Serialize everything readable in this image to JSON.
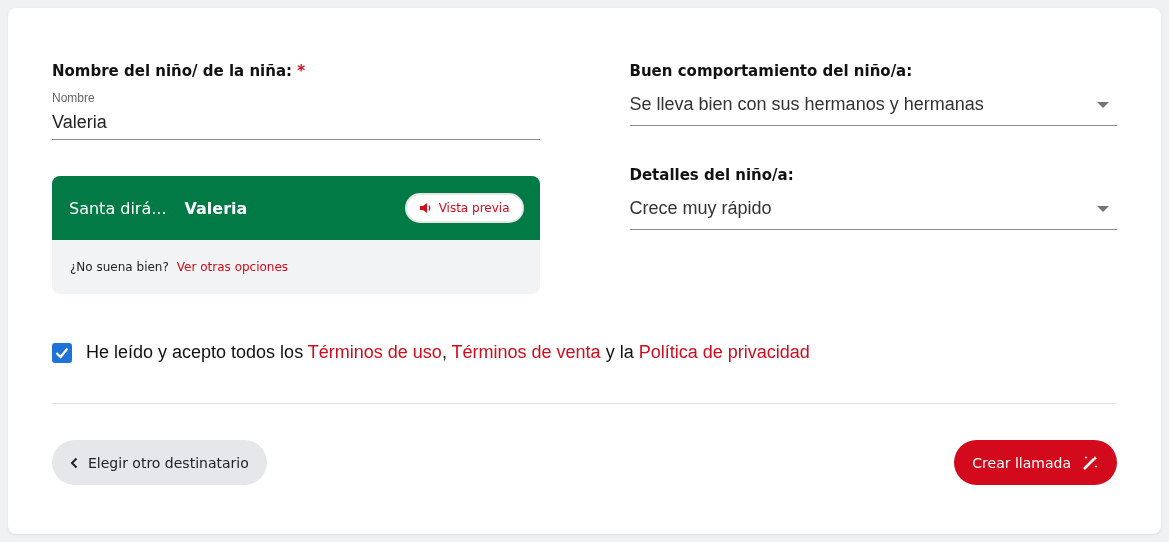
{
  "name_field": {
    "label": "Nombre del niño/ de la niña:",
    "required_mark": "*",
    "floating_label": "Nombre",
    "value": "Valeria"
  },
  "preview": {
    "lead": "Santa dirá...",
    "name": "Valeria",
    "button": "Vista previa",
    "question": "¿No suena bien?",
    "link": "Ver otras opciones"
  },
  "selects": [
    {
      "label": "Buen comportamiento del niño/a:",
      "value": "Se lleva bien con sus hermanos y hermanas"
    },
    {
      "label": "Detalles del niño/a:",
      "value": "Crece muy rápido"
    }
  ],
  "terms": {
    "checked": true,
    "lead": "He leído y acepto todos los ",
    "links": [
      {
        "text": "Términos de uso",
        "after": ", "
      },
      {
        "text": "Términos de venta",
        "after": " y la "
      },
      {
        "text": "Política de privacidad"
      }
    ]
  },
  "back_button": "Elegir otro destinatario",
  "submit_button": "Crear llamada"
}
